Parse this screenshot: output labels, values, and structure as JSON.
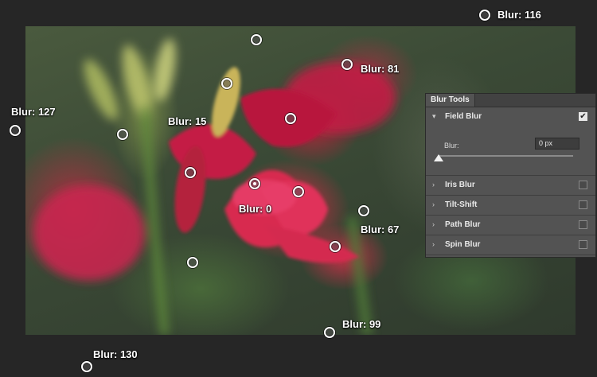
{
  "pins": [
    {
      "label": "Blur: 116",
      "active": false
    },
    {
      "label": "Blur: 81",
      "active": false
    },
    {
      "label": "Blur: 127",
      "active": false
    },
    {
      "label": "Blur: 15",
      "active": false
    },
    {
      "label": "Blur: 0",
      "active": true
    },
    {
      "label": "Blur: 67",
      "active": false
    },
    {
      "label": "Blur: 99",
      "active": false
    },
    {
      "label": "Blur: 130",
      "active": false
    }
  ],
  "panel": {
    "tab_label": "Blur Tools",
    "field_blur": {
      "title": "Field Blur",
      "checked": true,
      "blur_label": "Blur:",
      "blur_value": "0 px"
    },
    "sections": [
      {
        "title": "Iris Blur",
        "checked": false
      },
      {
        "title": "Tilt-Shift",
        "checked": false
      },
      {
        "title": "Path Blur",
        "checked": false
      },
      {
        "title": "Spin Blur",
        "checked": false
      }
    ],
    "icons": {
      "expanded": "▾",
      "collapsed": "›",
      "check": "✔"
    }
  }
}
